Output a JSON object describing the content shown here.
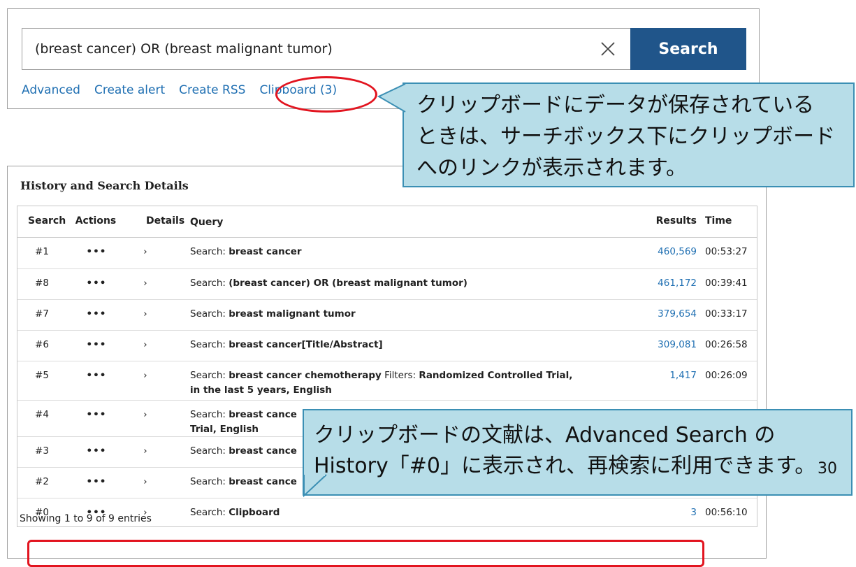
{
  "search": {
    "value": "(breast cancer) OR (breast malignant tumor)",
    "clear_icon": "close-icon",
    "button_label": "Search",
    "links": [
      "Advanced",
      "Create alert",
      "Create RSS",
      "Clipboard (3)"
    ]
  },
  "callouts": {
    "clipboard_note_lines": [
      "クリップボードにデータが保存されている",
      "ときは、サーチボックス下にクリップボード",
      "へのリンクが表示されます。"
    ],
    "history_note_lines": [
      "クリップボードの文献は、Advanced Search の",
      "History「#0」に表示され、再検索に利用できます。"
    ]
  },
  "history": {
    "title": "History and Search Details",
    "columns": [
      "Search",
      "Actions",
      "Details",
      "Query",
      "Results",
      "Time"
    ],
    "actions_glyph": "•••",
    "details_glyph": "›",
    "rows": [
      {
        "search": "#1",
        "query_prefix": "Search: ",
        "query_term": "breast cancer",
        "query_filters_label": "",
        "query_filters": "",
        "results": "460,569",
        "time": "00:53:27"
      },
      {
        "search": "#8",
        "query_prefix": "Search: ",
        "query_term": "(breast cancer) OR (breast malignant tumor)",
        "query_filters_label": "",
        "query_filters": "",
        "results": "461,172",
        "time": "00:39:41"
      },
      {
        "search": "#7",
        "query_prefix": "Search: ",
        "query_term": "breast malignant tumor",
        "query_filters_label": "",
        "query_filters": "",
        "results": "379,654",
        "time": "00:33:17"
      },
      {
        "search": "#6",
        "query_prefix": "Search: ",
        "query_term": "breast cancer[Title/Abstract]",
        "query_filters_label": "",
        "query_filters": "",
        "results": "309,081",
        "time": "00:26:58"
      },
      {
        "search": "#5",
        "query_prefix": "Search: ",
        "query_term": "breast cancer chemotherapy",
        "query_filters_label": " Filters: ",
        "query_filters": "Randomized Controlled Trial, in the last 5 years, English",
        "results": "1,417",
        "time": "00:26:09"
      },
      {
        "search": "#4",
        "query_prefix": "Search: ",
        "query_term": "breast cance",
        "query_filters_label": "",
        "query_filters": "Trial, English",
        "results": "",
        "time": ""
      },
      {
        "search": "#3",
        "query_prefix": "Search: ",
        "query_term": "breast cance",
        "query_filters_label": "",
        "query_filters": "",
        "results": "",
        "time": ""
      },
      {
        "search": "#2",
        "query_prefix": "Search: ",
        "query_term": "breast cance",
        "query_filters_label": "",
        "query_filters": "",
        "results": "",
        "time": ""
      },
      {
        "search": "#0",
        "query_prefix": "Search: ",
        "query_term": "Clipboard",
        "query_filters_label": "",
        "query_filters": "",
        "results": "3",
        "time": "00:56:10"
      }
    ],
    "showing": "Showing 1 to 9 of 9 entries"
  },
  "page_number": "30",
  "colors": {
    "accent_blue": "#20558a",
    "link_blue": "#1f6fb2",
    "highlight_red": "#e2141f",
    "callout_fill": "#b7dde8",
    "callout_border": "#3b8fb4"
  }
}
